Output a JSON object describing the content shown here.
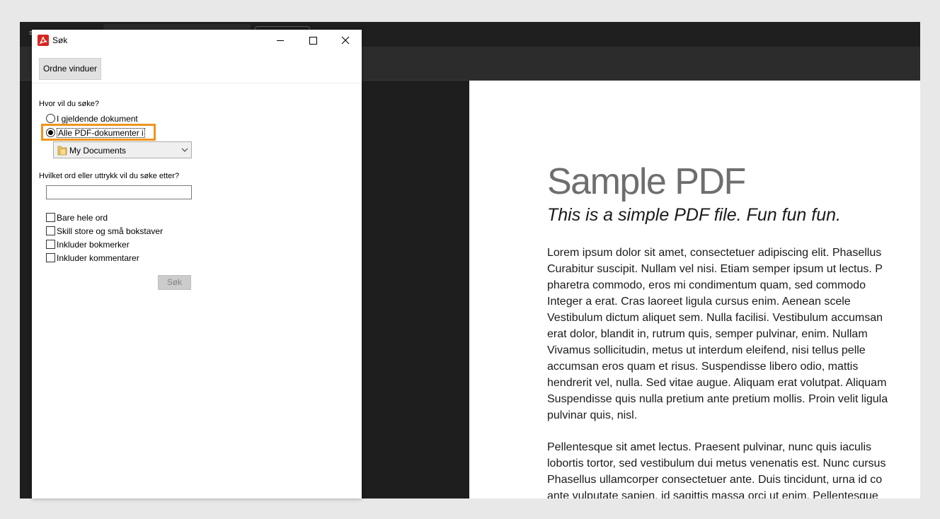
{
  "dialog": {
    "title": "Søk",
    "arrange_windows_label": "Ordne vinduer",
    "where_label": "Hvor vil du søke?",
    "scope_options": [
      {
        "label": "I gjeldende dokument",
        "selected": false
      },
      {
        "label": "Alle PDF-dokumenter i",
        "selected": true
      }
    ],
    "folder_select_value": "My Documents",
    "what_label": "Hvilket ord eller uttrykk vil du søke etter?",
    "search_input_value": "",
    "options": [
      {
        "label": "Bare hele ord",
        "checked": false
      },
      {
        "label": "Skill store og små bokstaver",
        "checked": false
      },
      {
        "label": "Inkluder bokmerker",
        "checked": false
      },
      {
        "label": "Inkluder kommentarer",
        "checked": false
      }
    ],
    "search_button_label": "Søk",
    "highlight_color": "#f0941e",
    "icons": {
      "app": "acrobat-icon",
      "minimize": "minimize-icon",
      "maximize": "maximize-icon",
      "close": "close-icon",
      "folder": "folder-icon",
      "dropdown": "chevron-down-icon"
    }
  },
  "pdf": {
    "title": "Sample PDF",
    "subtitle": "This is a simple PDF file. Fun fun fun.",
    "paragraph1_lines": [
      "Lorem ipsum dolor sit amet, consectetuer adipiscing elit. Phasellus",
      "Curabitur suscipit. Nullam vel nisi. Etiam semper ipsum ut lectus. P",
      "pharetra commodo, eros mi condimentum quam, sed commodo",
      "Integer a erat. Cras laoreet ligula cursus enim. Aenean scele",
      "Vestibulum dictum aliquet sem. Nulla facilisi. Vestibulum accumsan",
      "erat dolor, blandit in, rutrum quis, semper pulvinar, enim. Nullam",
      "Vivamus sollicitudin, metus ut interdum eleifend, nisi tellus pelle",
      "accumsan eros quam et risus. Suspendisse libero odio, mattis",
      "hendrerit vel, nulla. Sed vitae augue. Aliquam erat volutpat. Aliquam",
      "Suspendisse quis nulla pretium ante pretium mollis. Proin velit ligula",
      "pulvinar quis, nisl."
    ],
    "paragraph2_lines": [
      "Pellentesque sit amet lectus. Praesent pulvinar, nunc quis iaculis",
      "lobortis tortor, sed vestibulum dui metus venenatis est. Nunc cursus",
      "Phasellus ullamcorper consectetuer ante. Duis tincidunt, urna id co",
      "ante vulputate sapien, id sagittis massa orci ut enim. Pellentesque"
    ]
  }
}
